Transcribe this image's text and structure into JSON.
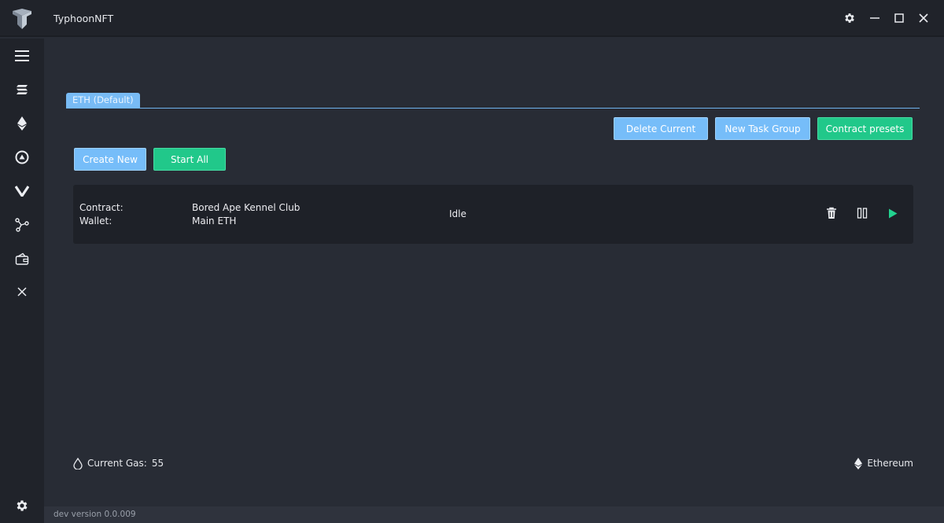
{
  "app": {
    "title": "TyphoonNFT"
  },
  "window_controls": [
    "gear-icon",
    "minimize-icon",
    "maximize-icon",
    "close-icon"
  ],
  "sidebar": {
    "items": [
      {
        "icon": "menu-icon"
      },
      {
        "icon": "solana-icon"
      },
      {
        "icon": "ethereum-icon"
      },
      {
        "icon": "opensea-icon"
      },
      {
        "icon": "vector-icon"
      },
      {
        "icon": "nodes-icon"
      },
      {
        "icon": "wallet-icon"
      },
      {
        "icon": "x-icon"
      },
      {
        "icon": "gear-icon"
      }
    ]
  },
  "tabs": [
    {
      "label": "ETH (Default)",
      "active": true
    }
  ],
  "toolbar": {
    "delete_current": "Delete Current",
    "new_task_group": "New Task Group",
    "contract_presets": "Contract presets",
    "create_new": "Create New",
    "start_all": "Start All"
  },
  "tasks": [
    {
      "contract_label": "Contract:",
      "contract_value": "Bored Ape Kennel Club",
      "wallet_label": "Wallet:",
      "wallet_value": "Main ETH",
      "status": "Idle"
    }
  ],
  "footer": {
    "gas_label": "Current Gas:",
    "gas_value": "55",
    "network": "Ethereum"
  },
  "statusbar": {
    "version": "dev version 0.0.009"
  },
  "colors": {
    "accent_blue": "#76bdf9",
    "accent_green": "#21c88a",
    "background": "#282c35",
    "sidebar": "#20232a"
  }
}
